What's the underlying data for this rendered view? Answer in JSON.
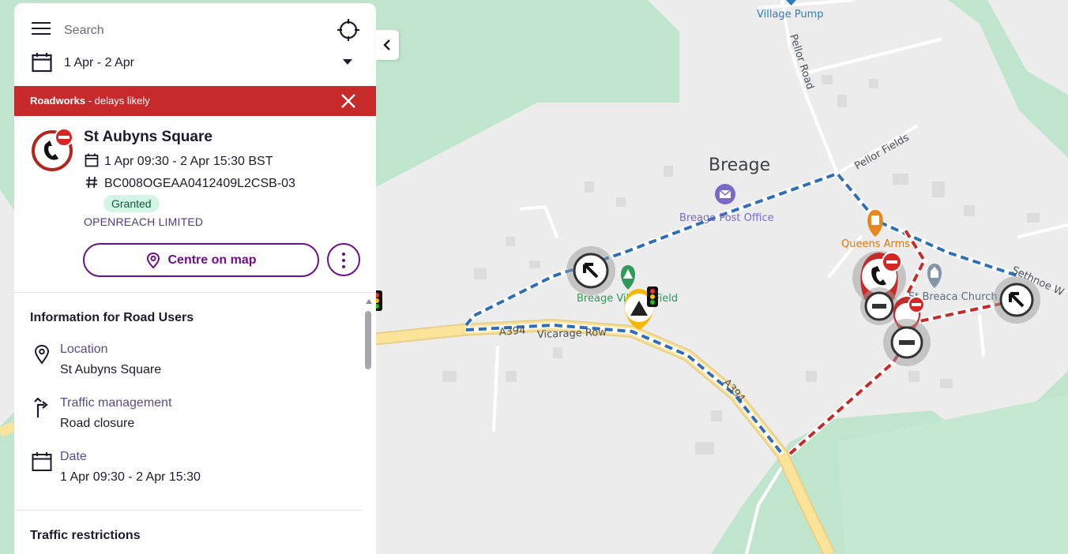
{
  "search": {
    "placeholder": "Search"
  },
  "date_filter": {
    "value": "1 Apr - 2 Apr"
  },
  "alert": {
    "title": "Roadworks",
    "subtitle": "- delays likely"
  },
  "works": {
    "title": "St Aubyns Square",
    "dates": "1 Apr 09:30 - 2 Apr 15:30 BST",
    "reference": "BC008OGEAA0412409L2CSB-03",
    "status": "Granted",
    "organisation": "OPENREACH LIMITED",
    "centre_button": "Centre on map"
  },
  "info": {
    "heading": "Information for Road Users",
    "items": [
      {
        "label": "Location",
        "value": "St Aubyns Square",
        "icon": "location-pin-icon"
      },
      {
        "label": "Traffic management",
        "value": "Road closure",
        "icon": "diversion-arrow-icon"
      },
      {
        "label": "Date",
        "value": "1 Apr 09:30 - 2 Apr 15:30",
        "icon": "calendar-icon"
      }
    ],
    "restrictions_heading": "Traffic restrictions"
  },
  "map": {
    "place": "Breage",
    "labels": {
      "village_pump": "Village Pump",
      "pellor_road": "Pellor Road",
      "pellor_fields": "Pellor Fields",
      "post_office": "Breage Post Office",
      "queens_arms": "Queens Arms",
      "village_field": "Breage Village Field",
      "church": "St Breaca Church",
      "a394_1": "A394",
      "vicarage_row": "Vicarage Row",
      "a394_2": "A394",
      "sethnoe": "Sethnoe W"
    }
  },
  "colors": {
    "accent": "#6b0f8a",
    "alert": "#c62a2a",
    "granted_bg": "#d3f5e6",
    "diversion_blue": "#2e6fb8",
    "closure_red": "#c62a2a"
  }
}
